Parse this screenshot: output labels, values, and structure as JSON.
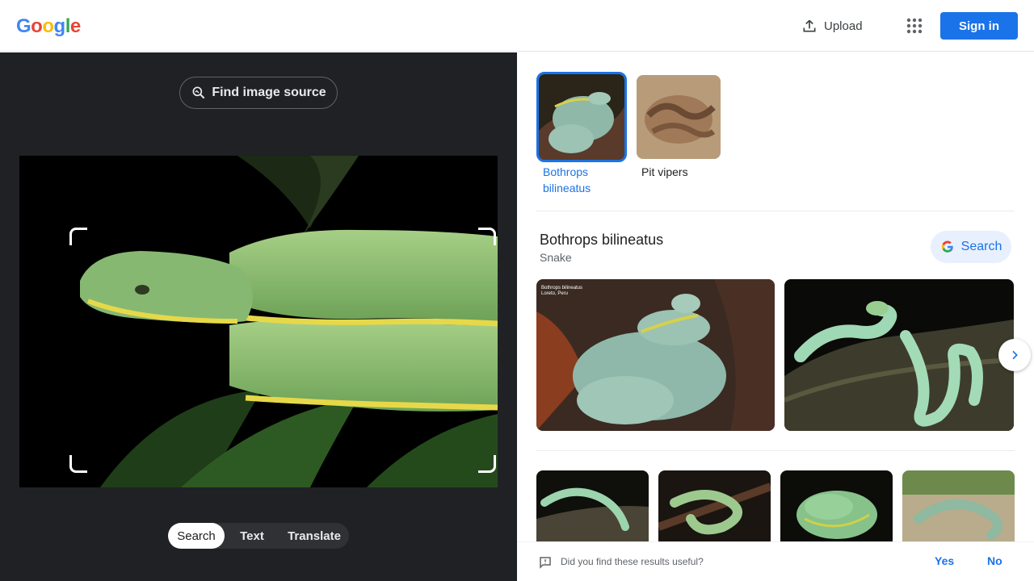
{
  "header": {
    "logo_letters": [
      "G",
      "o",
      "o",
      "g",
      "l",
      "e"
    ],
    "logo_colors": [
      "#4285f4",
      "#ea4335",
      "#fbbc05",
      "#4285f4",
      "#34a853",
      "#ea4335"
    ],
    "upload_label": "Upload",
    "apps_icon": "apps-grid-icon",
    "signin_label": "Sign in"
  },
  "left": {
    "find_source_label": "Find image source",
    "mode_tabs": [
      {
        "label": "Search",
        "active": true
      },
      {
        "label": "Text",
        "active": false
      },
      {
        "label": "Translate",
        "active": false
      }
    ]
  },
  "right": {
    "chips": [
      {
        "label": "Bothrops bilineatus",
        "selected": true
      },
      {
        "label": "Pit vipers",
        "selected": false
      }
    ],
    "entity": {
      "title": "Bothrops bilineatus",
      "subtitle": "Snake",
      "search_label": "Search"
    },
    "feedback": {
      "question": "Did you find these results useful?",
      "yes": "Yes",
      "no": "No"
    }
  },
  "colors": {
    "accent": "#1a73e8",
    "dark_panel": "#202124",
    "snake_green": "#7fb56a"
  }
}
